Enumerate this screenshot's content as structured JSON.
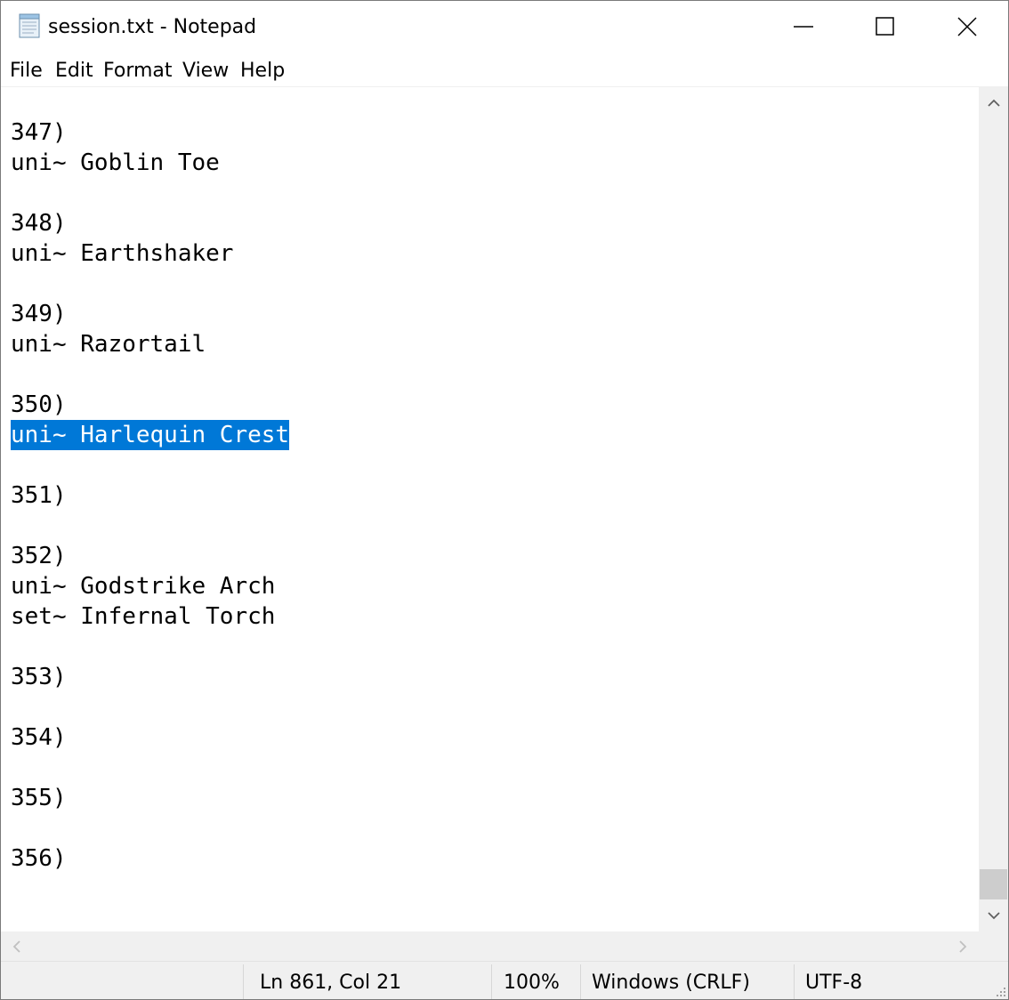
{
  "window": {
    "title": "session.txt - Notepad"
  },
  "titlebar": {
    "minimize_icon": "minimize-icon",
    "maximize_icon": "maximize-icon",
    "close_icon": "close-icon",
    "app_icon": "notepad-icon"
  },
  "menu": {
    "items": [
      "File",
      "Edit",
      "Format",
      "View",
      "Help"
    ]
  },
  "editor": {
    "lines": [
      "347)",
      "uni~ Goblin Toe",
      "",
      "348)",
      "uni~ Earthshaker",
      "",
      "349)",
      "uni~ Razortail",
      "",
      "350)",
      "uni~ Harlequin Crest",
      "",
      "351)",
      "",
      "352)",
      "uni~ Godstrike Arch",
      "set~ Infernal Torch",
      "",
      "353)",
      "",
      "354)",
      "",
      "355)",
      "",
      "356)"
    ],
    "selected_line": "uni~ Harlequin Crest",
    "selection_color": "#0078d7"
  },
  "statusbar": {
    "position": "Ln 861, Col 21",
    "zoom": "100%",
    "line_ending": "Windows (CRLF)",
    "encoding": "UTF-8"
  }
}
